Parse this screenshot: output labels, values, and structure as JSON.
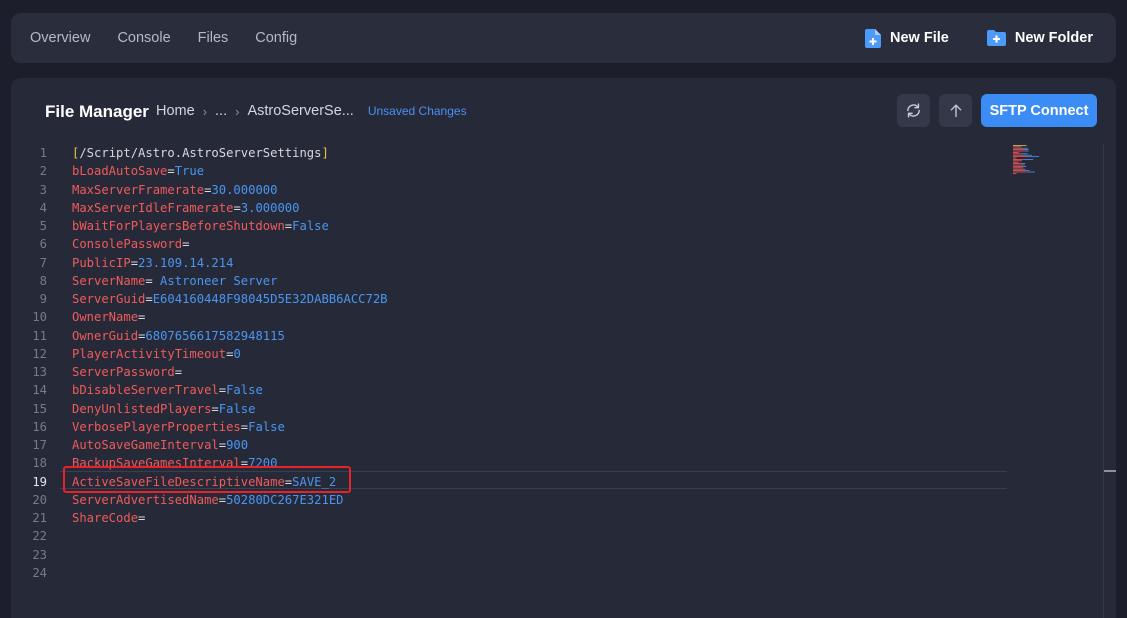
{
  "topbar": {
    "nav": [
      "Overview",
      "Console",
      "Files",
      "Config"
    ],
    "new_file": "New File",
    "new_folder": "New Folder"
  },
  "file_manager": {
    "title": "File Manager",
    "breadcrumb": [
      "Home",
      "...",
      "AstroServerSe..."
    ],
    "status": "Unsaved Changes",
    "refresh_icon": "refresh-icon",
    "upload_icon": "arrow-up-icon",
    "sftp_button": "SFTP Connect"
  },
  "editor": {
    "active_line": 19,
    "highlighted_line": 19,
    "lines": [
      {
        "num": "1",
        "section": "[/Script/Astro.AstroServerSettings]"
      },
      {
        "num": "2",
        "key": "bLoadAutoSave",
        "value": "True"
      },
      {
        "num": "3",
        "key": "MaxServerFramerate",
        "value": "30.000000"
      },
      {
        "num": "4",
        "key": "MaxServerIdleFramerate",
        "value": "3.000000"
      },
      {
        "num": "5",
        "key": "bWaitForPlayersBeforeShutdown",
        "value": "False"
      },
      {
        "num": "6",
        "key": "ConsolePassword",
        "value": ""
      },
      {
        "num": "7",
        "key": "PublicIP",
        "value": "23.109.14.214"
      },
      {
        "num": "8",
        "key": "ServerName",
        "value": " Astroneer Server"
      },
      {
        "num": "9",
        "key": "ServerGuid",
        "value": "E604160448F98045D5E32DABB6ACC72B"
      },
      {
        "num": "10",
        "key": "OwnerName",
        "value": ""
      },
      {
        "num": "11",
        "key": "OwnerGuid",
        "value": "6807656617582948115"
      },
      {
        "num": "12",
        "key": "PlayerActivityTimeout",
        "value": "0"
      },
      {
        "num": "13",
        "key": "ServerPassword",
        "value": ""
      },
      {
        "num": "14",
        "key": "bDisableServerTravel",
        "value": "False"
      },
      {
        "num": "15",
        "key": "DenyUnlistedPlayers",
        "value": "False"
      },
      {
        "num": "16",
        "key": "VerbosePlayerProperties",
        "value": "False"
      },
      {
        "num": "17",
        "key": "AutoSaveGameInterval",
        "value": "900"
      },
      {
        "num": "18",
        "key": "BackupSaveGamesInterval",
        "value": "7200"
      },
      {
        "num": "19",
        "key": "ActiveSaveFileDescriptiveName",
        "value": "SAVE_2"
      },
      {
        "num": "20",
        "key": "ServerAdvertisedName",
        "value": "50280DC267E321ED"
      },
      {
        "num": "21",
        "key": "ShareCode",
        "value": ""
      },
      {
        "num": "22"
      },
      {
        "num": "23"
      },
      {
        "num": "24"
      }
    ]
  },
  "colors": {
    "accent": "#3b8cf5",
    "key": "#f05a5a",
    "value": "#4a95f0",
    "section": "#e6c24c",
    "highlight": "#e8222b"
  }
}
